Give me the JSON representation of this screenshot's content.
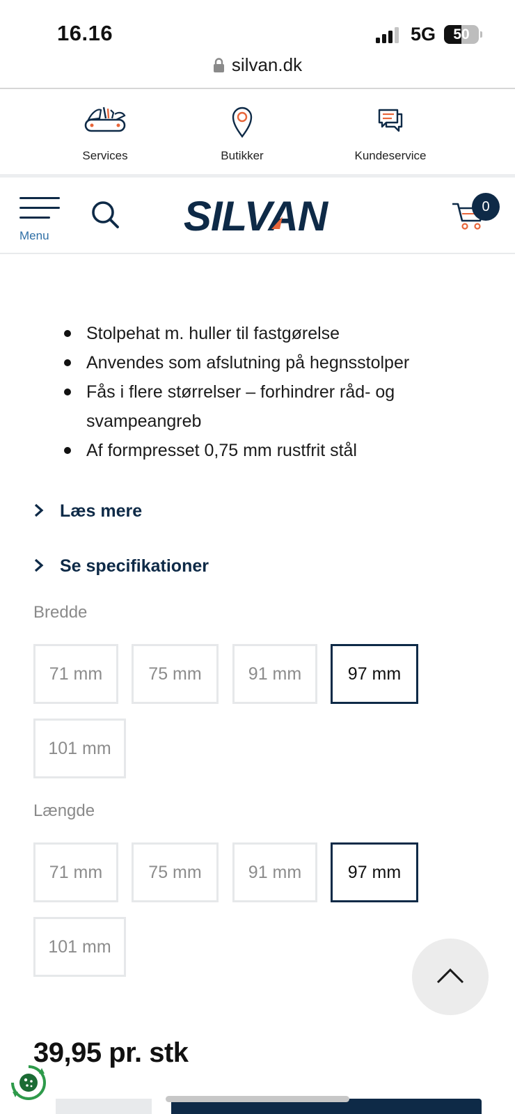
{
  "status_bar": {
    "time": "16.16",
    "network": "5G",
    "battery": "50"
  },
  "browser": {
    "url": "silvan.dk"
  },
  "quick_nav": [
    {
      "label": "Services",
      "icon": "knife-icon"
    },
    {
      "label": "Butikker",
      "icon": "map-pin-icon"
    },
    {
      "label": "Kundeservice",
      "icon": "chat-icon"
    }
  ],
  "header": {
    "menu_label": "Menu",
    "logo_text": "SILVAN",
    "cart_count": "0"
  },
  "product": {
    "bullets": [
      "Stolpehat m. huller til fastgørelse",
      "Anvendes som afslutning på hegnsstolper",
      "Fås i flere størrelser – forhindrer råd- og svampeangreb",
      "Af formpresset 0,75 mm rustfrit stål"
    ],
    "read_more": "Læs mere",
    "specs": "Se specifikationer",
    "width": {
      "label": "Bredde",
      "options": [
        "71 mm",
        "75 mm",
        "91 mm",
        "97 mm",
        "101 mm"
      ],
      "selected": "97 mm"
    },
    "length": {
      "label": "Længde",
      "options": [
        "71 mm",
        "75 mm",
        "91 mm",
        "97 mm",
        "101 mm"
      ],
      "selected": "97 mm"
    },
    "price": "39,95 pr. stk"
  },
  "colors": {
    "navy": "#0e2a47",
    "accent_orange": "#e8663a",
    "link_blue": "#2f6fa6"
  }
}
